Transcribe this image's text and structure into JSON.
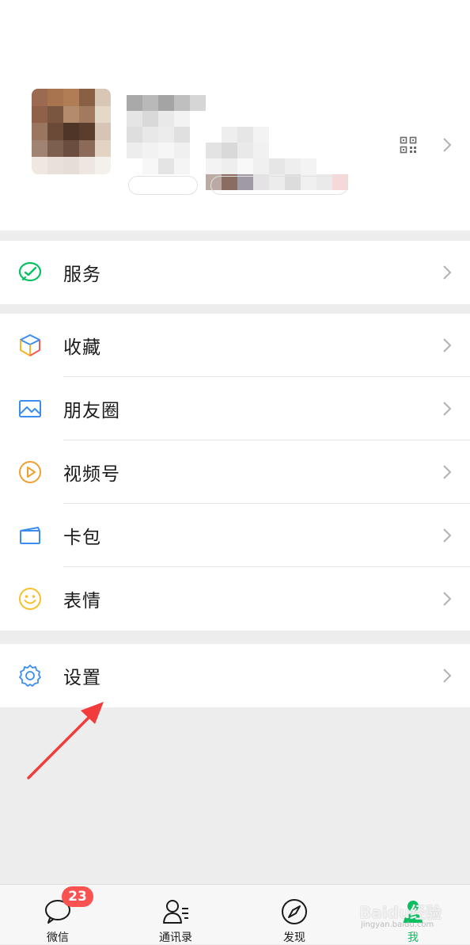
{
  "profile": {
    "avatar_colors": [
      "#9b6a50",
      "#a8734f",
      "#b07d55",
      "#8a6045",
      "#d8c7b5",
      "#8e6148",
      "#7a5540",
      "#b38c6c",
      "#a27b5f",
      "#e6d8c8",
      "#9a7560",
      "#6b4a38",
      "#4e3528",
      "#5a3d2d",
      "#d6c5b5",
      "#a08373",
      "#7d5f50",
      "#6a4d3e",
      "#8b6a59",
      "#e3d3c5",
      "#efe8e2",
      "#e9e0da",
      "#e6ddd6",
      "#eee7e1",
      "#f4f0ec"
    ],
    "name_colors": [
      "#a9a9a9",
      "#b9b9b9",
      "#a4a4a4",
      "#bfbfbf",
      "#d6d6d6",
      "#e5e5e5",
      "#d9d9d9",
      "#e9e9e9",
      "#f3f3f3",
      "#ffffff",
      "#dedede",
      "#e8e8e8",
      "#ececec",
      "#e0e0e0",
      "#ffffff",
      "#ededed",
      "#f2f2f2",
      "#f6f6f6",
      "#f0f0f0",
      "#ffffff",
      "#ffffff",
      "#f7f7f7",
      "#e4e4e4",
      "#f5f5f5",
      "#ffffff"
    ],
    "wx_colors": [
      "#ffffff",
      "#eeeeee",
      "#e6e6e6",
      "#f3f3f3",
      "#ffffff",
      "#ffffff",
      "#ffffff",
      "#ffffff",
      "#ffffff",
      "#e3e3e3",
      "#d9d9d9",
      "#e9e9e9",
      "#f1f1f1",
      "#ffffff",
      "#ffffff",
      "#ffffff",
      "#ffffff",
      "#ffffff",
      "#f3f3f3",
      "#eeeeee",
      "#f8f8f8",
      "#f0f0f0",
      "#e6e6e6",
      "#eeeeee",
      "#f3f3f3",
      "#ffffff",
      "#ffffff",
      "#b9aba4",
      "#8a6c62",
      "#a09aa5",
      "#e5e2e6",
      "#ececec",
      "#dcdcdc",
      "#f0f0f0",
      "#eaeaea",
      "#f7d8da"
    ]
  },
  "menu": {
    "services": {
      "label": "服务"
    },
    "group2": [
      {
        "key": "favorites",
        "label": "收藏"
      },
      {
        "key": "moments",
        "label": "朋友圈"
      },
      {
        "key": "channels",
        "label": "视频号"
      },
      {
        "key": "cards",
        "label": "卡包"
      },
      {
        "key": "stickers",
        "label": "表情"
      }
    ],
    "settings": {
      "label": "设置"
    }
  },
  "tabbar": {
    "chats": {
      "label": "微信",
      "badge": "23"
    },
    "contacts": {
      "label": "通讯录"
    },
    "discover": {
      "label": "发现"
    },
    "me": {
      "label": "我"
    }
  },
  "watermark": {
    "text": "Baidu经验",
    "sub": "jingyan.baidu.com"
  },
  "colors": {
    "accent_green": "#07c160",
    "badge_red": "#fa5151",
    "arrow_red": "#f23c3c",
    "background": "#ededed"
  }
}
